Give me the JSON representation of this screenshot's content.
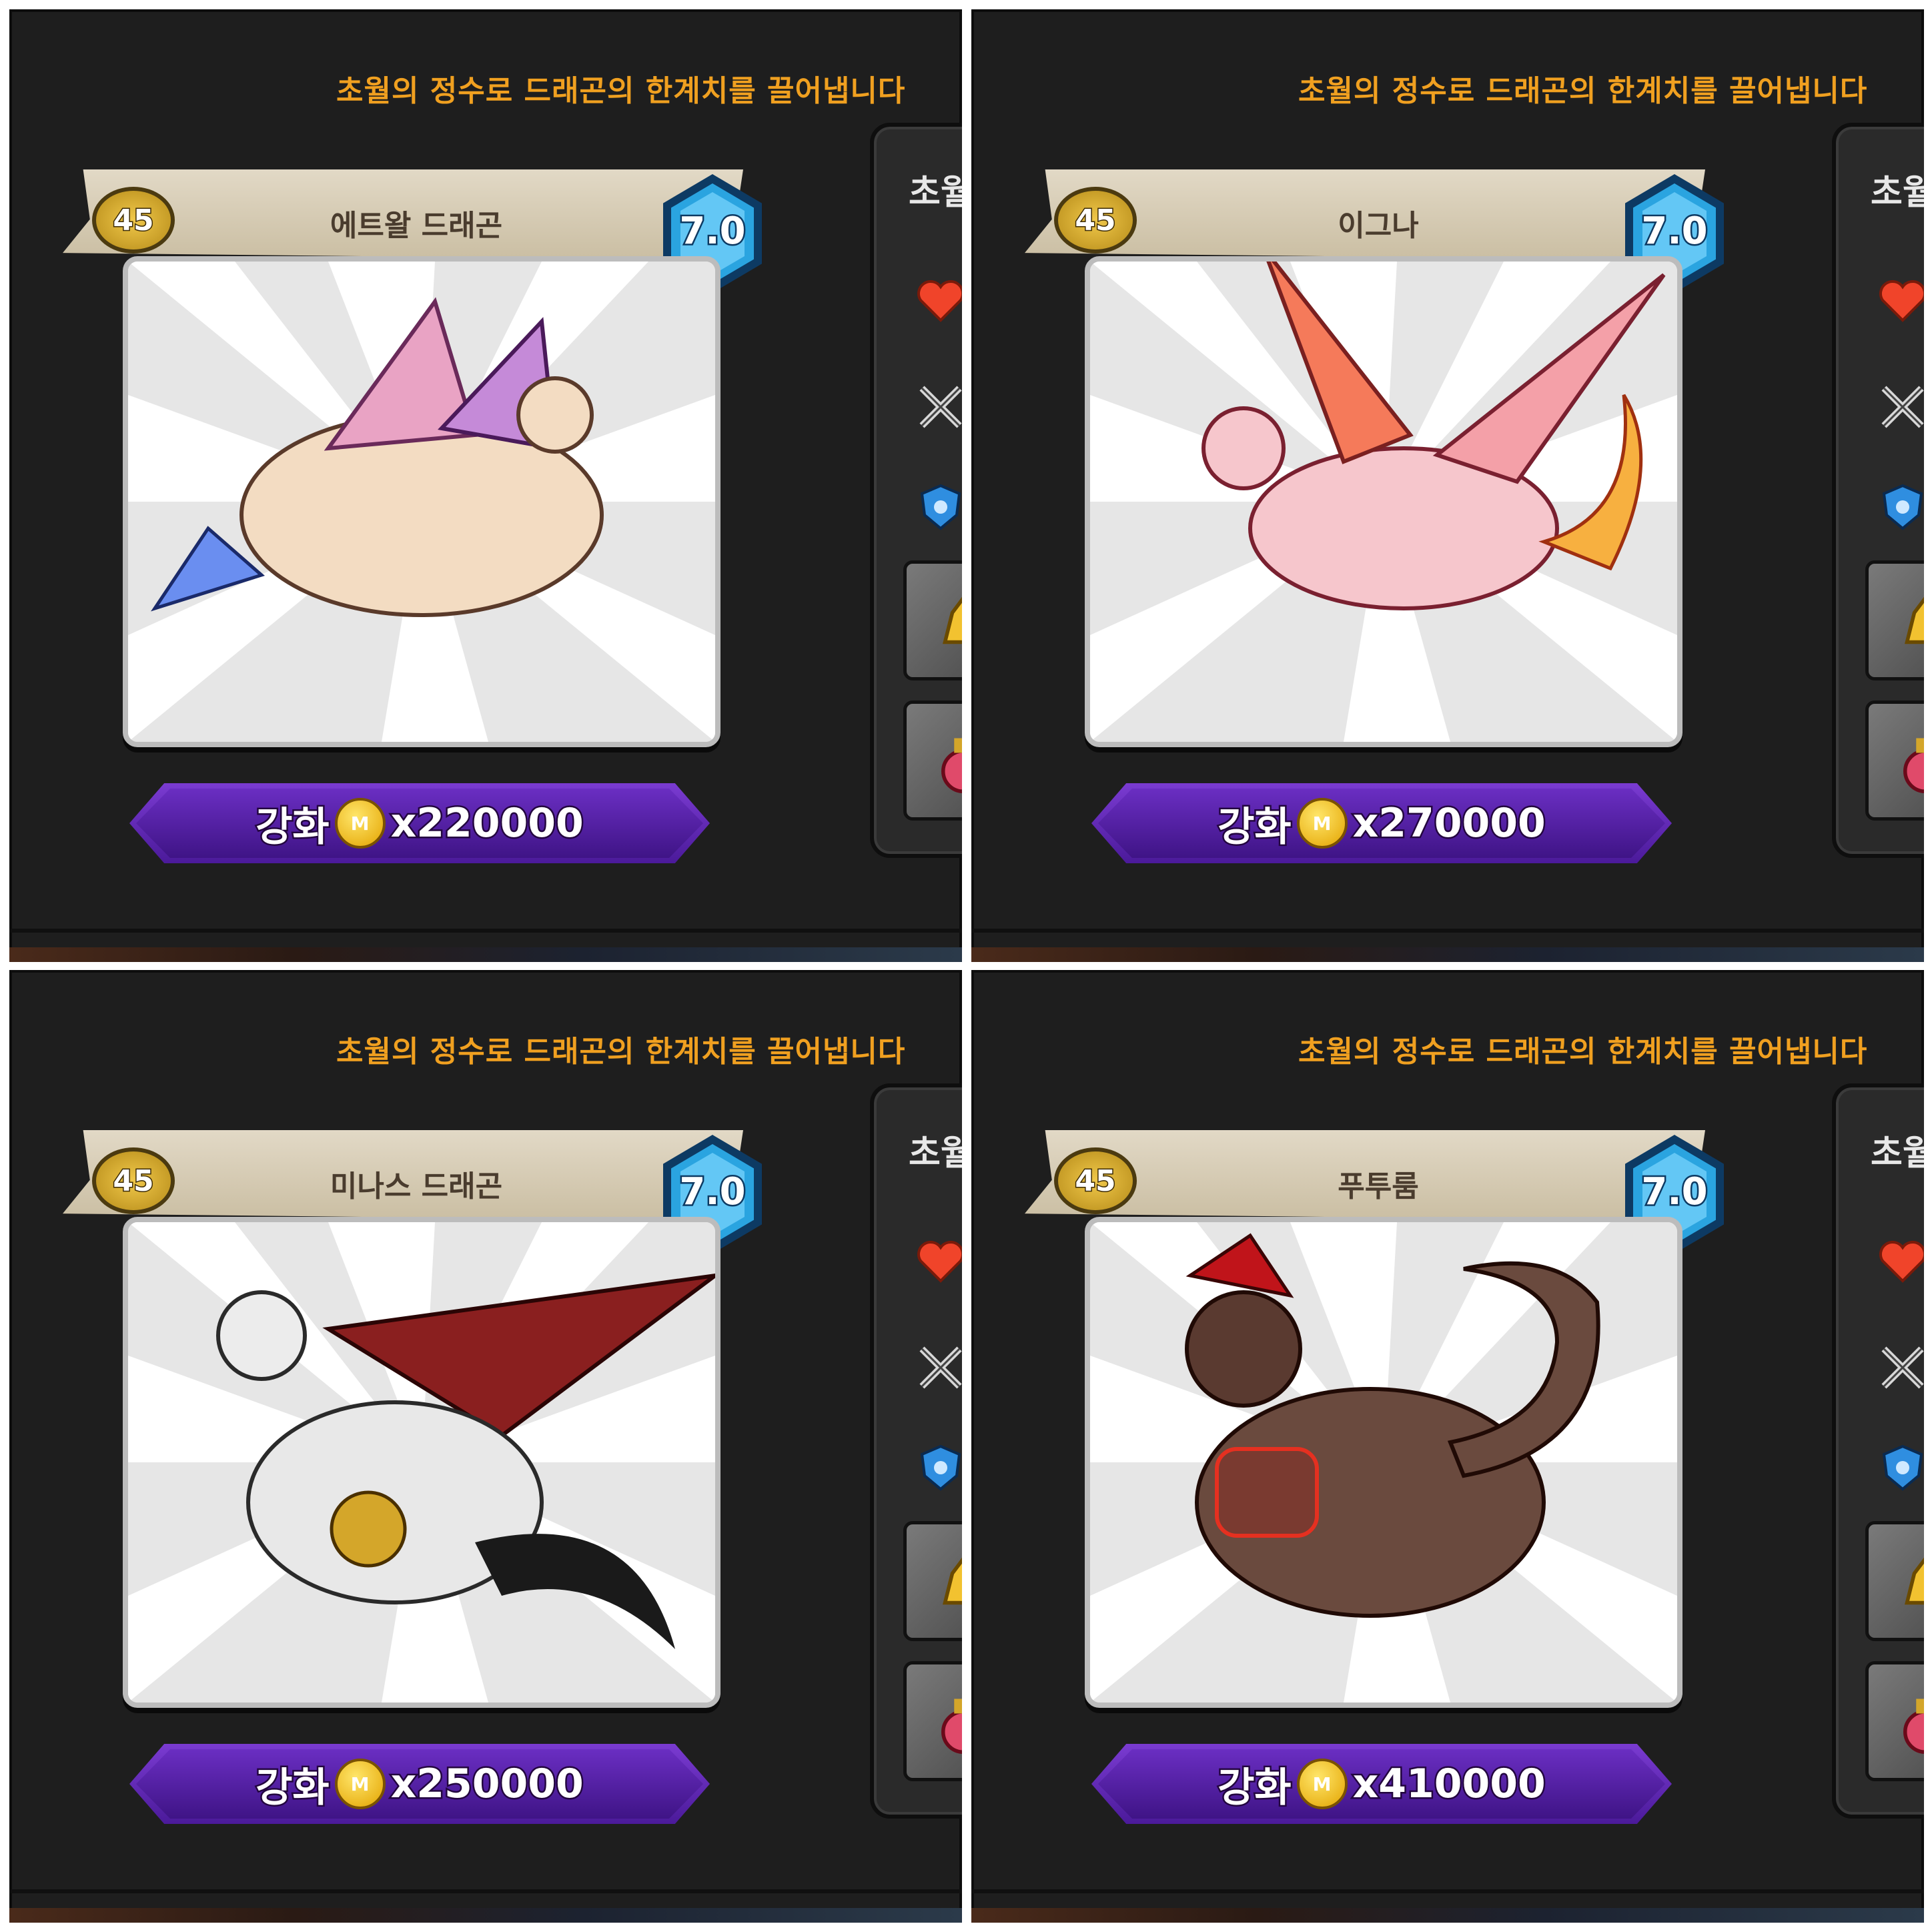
{
  "panels": [
    {
      "hint": "초월의 정수로 드래곤의 한계치를 끌어냅니다",
      "side_title": "초월",
      "level": "45",
      "dragon_name": "에트왈 드래곤",
      "grade": "7.0",
      "upgrade_label": "강화",
      "coin_mark": "M",
      "upgrade_cost": "x220000",
      "accent": "#e9a3c4"
    },
    {
      "hint": "초월의 정수로 드래곤의 한계치를 끌어냅니다",
      "side_title": "초월",
      "level": "45",
      "dragon_name": "이그나",
      "grade": "7.0",
      "upgrade_label": "강화",
      "coin_mark": "M",
      "upgrade_cost": "x270000",
      "accent": "#f05a4a"
    },
    {
      "hint": "초월의 정수로 드래곤의 한계치를 끌어냅니다",
      "side_title": "초월",
      "level": "45",
      "dragon_name": "미나스 드래곤",
      "grade": "7.0",
      "upgrade_label": "강화",
      "coin_mark": "M",
      "upgrade_cost": "x250000",
      "accent": "#8a1f1f"
    },
    {
      "hint": "초월의 정수로 드래곤의 한계치를 끌어냅니다",
      "side_title": "초월",
      "level": "45",
      "dragon_name": "푸투룸",
      "grade": "7.0",
      "upgrade_label": "강화",
      "coin_mark": "M",
      "upgrade_cost": "x410000",
      "accent": "#c0141a"
    }
  ],
  "icons": [
    "heart-icon",
    "crossed-swords-icon",
    "shield-icon",
    "golden-item-icon",
    "potion-item-icon",
    "coin-icon"
  ],
  "colors": {
    "hint_text": "#f0a020",
    "button_purple": "#5a24b0",
    "grade_hex": "#2aa4e0",
    "level_badge": "#d4a62a"
  }
}
